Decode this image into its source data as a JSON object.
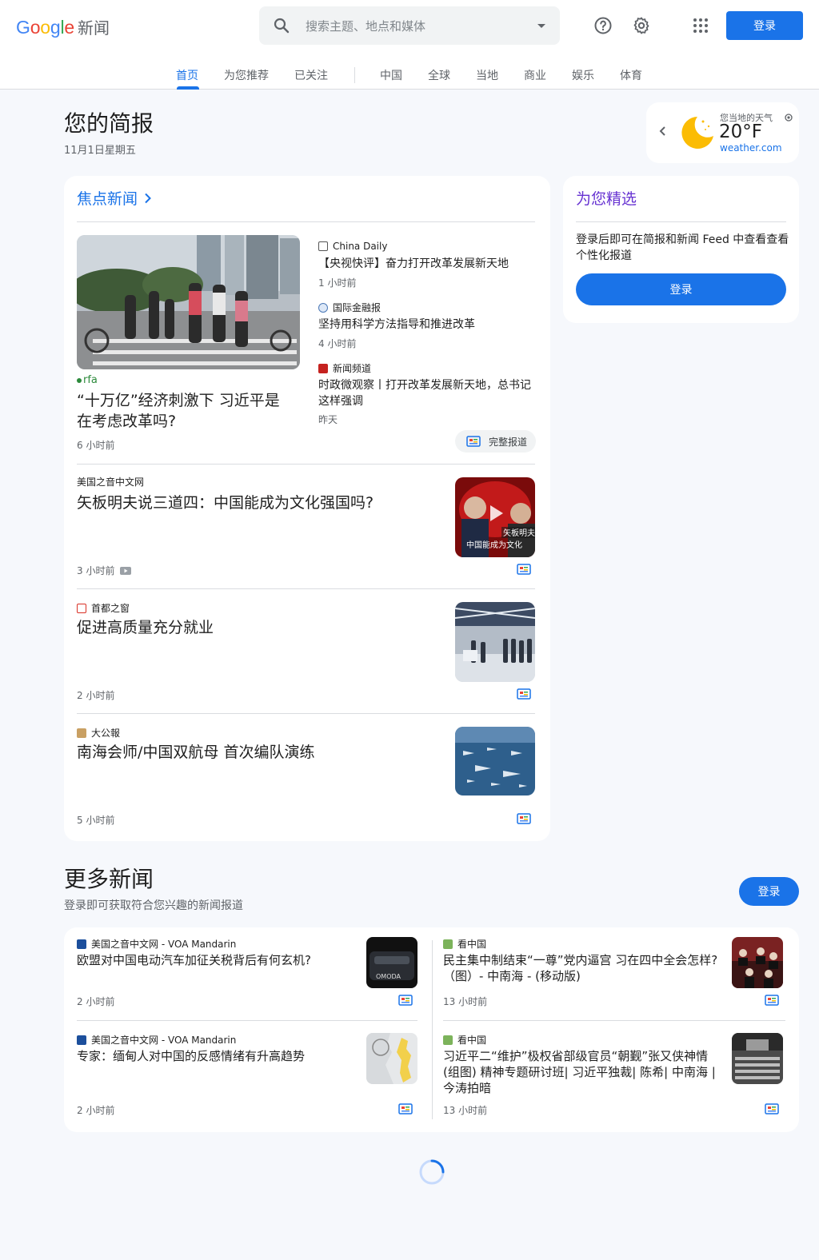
{
  "app": {
    "logo_google": "Google",
    "logo_product": "新闻"
  },
  "search": {
    "placeholder": "搜索主题、地点和媒体"
  },
  "header": {
    "signin_label": "登录",
    "help_icon": "help-icon",
    "settings_icon": "gear-icon",
    "apps_icon": "apps-grid-icon"
  },
  "tabs": [
    "首页",
    "为您推荐",
    "已关注",
    "中国",
    "全球",
    "当地",
    "商业",
    "娱乐",
    "体育"
  ],
  "briefing": {
    "title": "您的简报",
    "date": "11月1日星期五"
  },
  "weather": {
    "label": "您当地的天气",
    "temp": "20°F",
    "source": "weather.com"
  },
  "top_stories": {
    "heading": "焦点新闻",
    "hero": {
      "source": "rfa",
      "title": "“十万亿”经济刺激下 习近平是在考虑改革吗?",
      "time": "6 小时前"
    },
    "related": [
      {
        "source": "China Daily",
        "title": "【央视快评】奋力打开改革发展新天地",
        "time": "1 小时前"
      },
      {
        "source": "国际金融报",
        "title": "坚持用科学方法指导和推进改革",
        "time": "4 小时前"
      },
      {
        "source": "新闻频道",
        "title": "时政微观察丨打开改革发展新天地，总书记这样强调",
        "time": "昨天"
      }
    ],
    "full_coverage": "完整报道",
    "stories": [
      {
        "source": "美国之音中文网",
        "title": "矢板明夫说三道四：中国能成为文化强国吗?",
        "time": "3 小时前",
        "thumb_caption_1": "矢板明夫 说",
        "thumb_caption_2": "中国能成为文化"
      },
      {
        "source": "首都之窗",
        "title": "促进高质量充分就业",
        "time": "2 小时前"
      },
      {
        "source": "大公報",
        "title": "南海会师/中国双航母 首次编队演练",
        "time": "5 小时前"
      }
    ]
  },
  "picks": {
    "title": "为您精选",
    "desc": "登录后即可在简报和新闻 Feed 中查看查看个性化报道",
    "button": "登录"
  },
  "more_news": {
    "title": "更多新闻",
    "subtitle": "登录即可获取符合您兴趣的新闻报道",
    "button": "登录",
    "items": [
      {
        "source": "美国之音中文网 - VOA Mandarin",
        "title": "欧盟对中国电动汽车加征关税背后有何玄机?",
        "time": "2 小时前",
        "thumb_text": "OMODA"
      },
      {
        "source": "看中国",
        "title": "民主集中制结束“一尊”党内逼宫 习在四中全会怎样?（图）- 中南海 - (移动版)",
        "time": "13 小时前"
      },
      {
        "source": "美国之音中文网 - VOA Mandarin",
        "title": "专家：缅甸人对中国的反感情绪有升高趋势",
        "time": "2 小时前"
      },
      {
        "source": "看中国",
        "title": "习近平二“维护”极权省部级官员“朝觐”张又侠神情(组图) 精神专题研讨班| 习近平独裁| 陈希| 中南海 |今涛拍暗",
        "time": "13 小时前"
      }
    ]
  },
  "colors": {
    "accent": "#1a73e8",
    "picks": "#6733d2",
    "background": "#f6f8fc"
  }
}
